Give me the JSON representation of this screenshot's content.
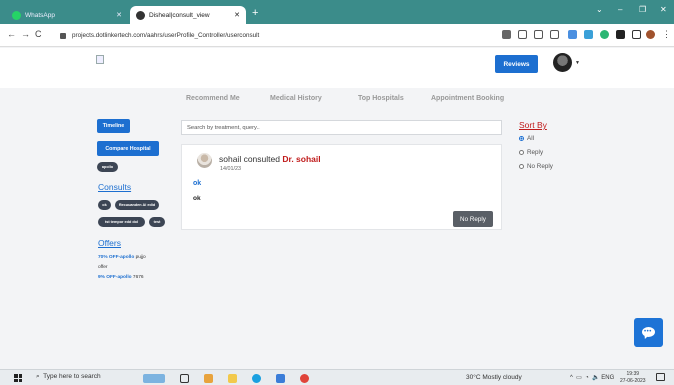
{
  "browser": {
    "tabs": [
      {
        "title": "WhatsApp",
        "active": false
      },
      {
        "title": "Disheal|consult_view",
        "active": true
      }
    ],
    "new_tab": "+",
    "url": "projects.dotlinkertech.com/aahrs/userProfile_Controller/userconsult",
    "window_controls": {
      "minimize": "⌄",
      "restore": "–",
      "maximize": "❐",
      "close": "✕"
    }
  },
  "header": {
    "reviews_label": "Reviews"
  },
  "nav_tabs": [
    "Recommend Me",
    "Medical History",
    "Top Hospitals",
    "Appointment Booking"
  ],
  "sidebar": {
    "timeline_label": "Timeline",
    "compare_label": "Compare Hospital",
    "hospital_tag": "apollo",
    "consults_heading": "Consults",
    "consult_tags": [
      "ok",
      "Recuuanden Ai edid",
      "tst tempor edd dol",
      "test"
    ],
    "offers_heading": "Offers",
    "offers": [
      {
        "link": "70% OFF-apollo",
        "text": " pujjo"
      },
      {
        "link": "",
        "text": "offer"
      },
      {
        "link": "9% OFF-apollo",
        "text": " 7676"
      }
    ]
  },
  "search": {
    "placeholder": "Search by treatment, query.."
  },
  "consult_card": {
    "patient": "sohail",
    "verb": " consulted ",
    "doctor": "Dr. sohail",
    "date": "14/01/23",
    "subject": "ok",
    "body": "ok",
    "action_label": "No Reply"
  },
  "sort": {
    "title": "Sort By",
    "options": [
      "All",
      "Reply",
      "No Reply"
    ],
    "selected": "All"
  },
  "taskbar": {
    "search_placeholder": "Type here to search",
    "weather": "30°C  Mostly cloudy",
    "tray": "ENG",
    "time": "19:39",
    "date": "27-06-2023"
  },
  "colors": {
    "accent": "#1d6fd0",
    "doctor_red": "#c01a1a",
    "tab_bar": "#3b8c8a"
  }
}
